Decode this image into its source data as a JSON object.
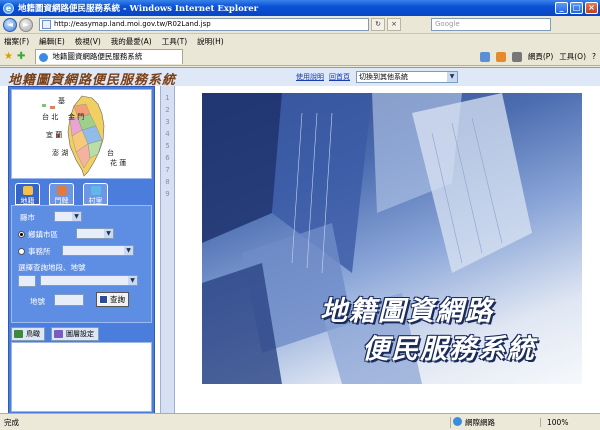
{
  "window": {
    "title": "地籍圖資網路便民服務系統 - Windows Internet Explorer",
    "app_icon_glyph": "e",
    "minimize_glyph": "_",
    "maximize_glyph": "□",
    "close_glyph": "×"
  },
  "address_bar": {
    "back_glyph": "◄",
    "forward_glyph": "►",
    "url": "http://easymap.land.moi.gov.tw/R02Land.jsp",
    "refresh_glyph": "↻",
    "stop_glyph": "×",
    "search_placeholder": "Google"
  },
  "menu": {
    "items": [
      "檔案(F)",
      "編輯(E)",
      "檢視(V)",
      "我的最愛(A)",
      "工具(T)",
      "說明(H)"
    ]
  },
  "tab_bar": {
    "tab_label": "地籍圖資網路便民服務系統",
    "page_menu": "網頁(P)",
    "tools_menu": "工具(O)",
    "help_glyph": "?"
  },
  "site": {
    "title": "地籍圖資網路便民服務系統",
    "links": {
      "help": "使用說明",
      "home": "回首頁"
    },
    "switch_select": "切換到其他系統",
    "dropdown_glyph": "▼"
  },
  "map": {
    "labels": [
      "基",
      "台 北",
      "宜 蘭",
      "台",
      "花 蓮",
      "澎 湖",
      "金 門"
    ]
  },
  "panel_tabs": [
    "地籍",
    "門牌",
    "村里"
  ],
  "form": {
    "county_label": "縣市",
    "district_radio": "鄉鎮市區",
    "office_radio": "事務所",
    "section_label": "選擇查詢地段、地號",
    "lot_label": "地號",
    "query_button": "查詢"
  },
  "bottom_tabs": {
    "overview": "鳥瞰",
    "layers": "圖層設定"
  },
  "strip_numbers": [
    "1",
    "2",
    "3",
    "4",
    "5",
    "6",
    "7",
    "8",
    "9"
  ],
  "splash": {
    "line1": "地籍圖資網路",
    "line2": "便民服務系統"
  },
  "status": {
    "left": "完成",
    "zone": "網際網路",
    "zoom": "100%"
  },
  "colors": {
    "panel_blue": "#4a7ddc",
    "header_bg": "#dfe8f6",
    "title_brown": "#7a3f14",
    "link_blue": "#1a3db0"
  }
}
